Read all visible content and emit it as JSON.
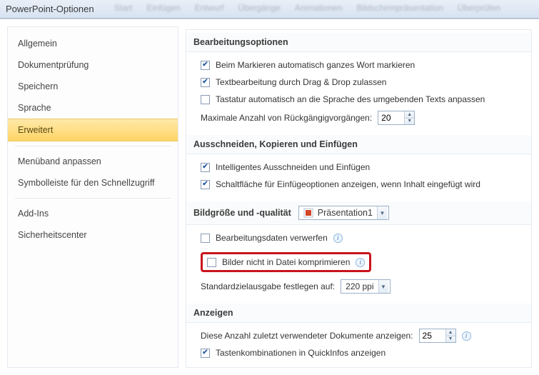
{
  "window": {
    "title": "PowerPoint-Optionen",
    "bg_tabs": [
      "Start",
      "Einfügen",
      "Entwurf",
      "Übergänge",
      "Animationen",
      "Bildschirmpräsentation",
      "Überprüfen"
    ]
  },
  "sidebar": {
    "items": [
      {
        "label": "Allgemein"
      },
      {
        "label": "Dokumentprüfung"
      },
      {
        "label": "Speichern"
      },
      {
        "label": "Sprache"
      },
      {
        "label": "Erweitert",
        "selected": true
      },
      {
        "label": "Menüband anpassen"
      },
      {
        "label": "Symbolleiste für den Schnellzugriff"
      },
      {
        "label": "Add-Ins"
      },
      {
        "label": "Sicherheitscenter"
      }
    ]
  },
  "sections": {
    "edit": {
      "title": "Bearbeitungsoptionen",
      "opt_select_word": "Beim Markieren automatisch ganzes Wort markieren",
      "opt_dragdrop": "Textbearbeitung durch Drag & Drop zulassen",
      "opt_keyboard": "Tastatur automatisch an die Sprache des umgebenden Texts anpassen",
      "undo_label": "Maximale Anzahl von Rückgängigvorgängen:",
      "undo_value": "20"
    },
    "clip": {
      "title": "Ausschneiden, Kopieren und Einfügen",
      "opt_smartcut": "Intelligentes Ausschneiden und Einfügen",
      "opt_pastebtn": "Schaltfläche für Einfügeoptionen anzeigen, wenn Inhalt eingefügt wird"
    },
    "image": {
      "title": "Bildgröße und -qualität",
      "dropdown_value": "Präsentation1",
      "opt_discard": "Bearbeitungsdaten verwerfen",
      "opt_nocompress": "Bilder nicht in Datei komprimieren",
      "target_label": "Standardzielausgabe festlegen auf:",
      "target_value": "220 ppi"
    },
    "display": {
      "title": "Anzeigen",
      "recent_label": "Diese Anzahl zuletzt verwendeter Dokumente anzeigen:",
      "recent_value": "25",
      "opt_shortcuts": "Tastenkombinationen in QuickInfos anzeigen"
    }
  }
}
